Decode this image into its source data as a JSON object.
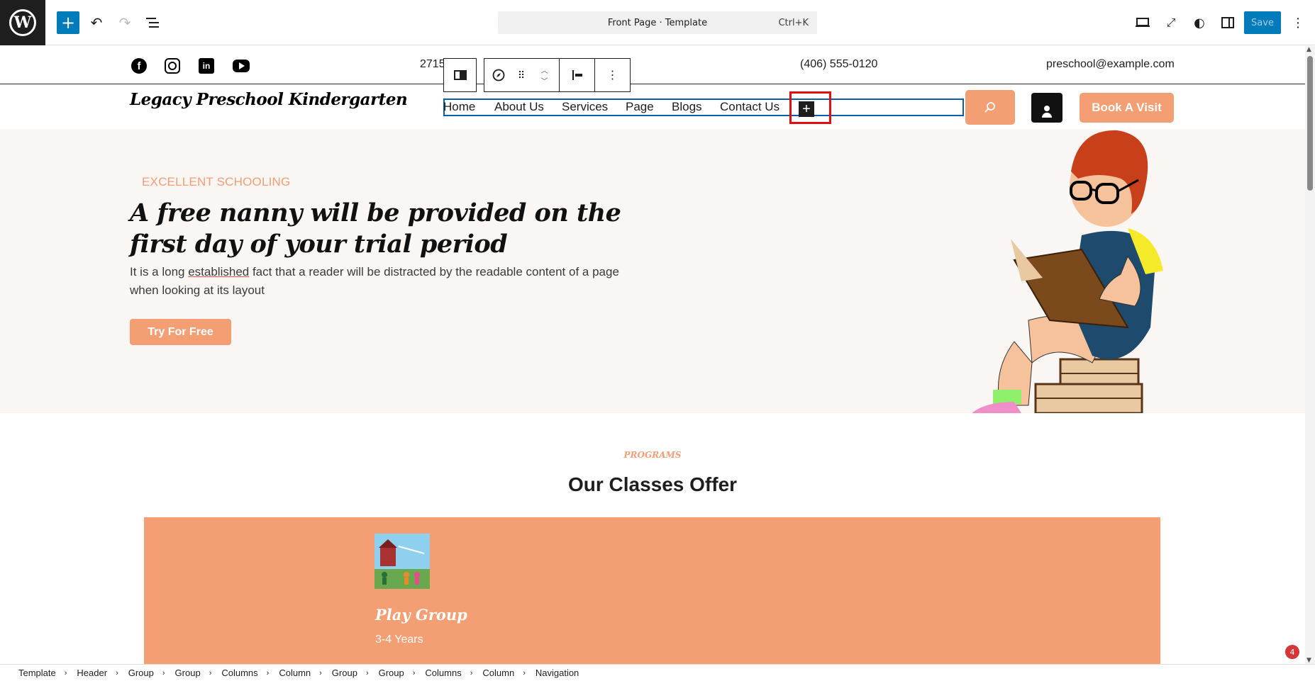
{
  "editor": {
    "command_label": "Front Page · Template",
    "command_shortcut": "Ctrl+K",
    "save_label": "Save",
    "notice_count": "4"
  },
  "site": {
    "address": "2715",
    "phone": "(406) 555-0120",
    "email": "preschool@example.com",
    "title": "Legacy Preschool Kindergarten",
    "nav": [
      "Home",
      "About Us",
      "Services",
      "Page",
      "Blogs",
      "Contact Us"
    ],
    "book_label": "Book A Visit"
  },
  "hero": {
    "eyebrow": "EXCELLENT SCHOOLING",
    "title": "A free nanny will be provided on the first day of your trial period",
    "text_before": "It is a long ",
    "text_underlined": "established",
    "text_after": " fact that a reader will be distracted by the readable content of a page when looking at its layout",
    "cta": "Try For Free"
  },
  "programs": {
    "eyebrow": "PROGRAMS",
    "title": "Our Classes Offer",
    "card_title": "Play Group",
    "card_sub": "3-4 Years"
  },
  "breadcrumbs": [
    "Template",
    "Header",
    "Group",
    "Group",
    "Columns",
    "Column",
    "Group",
    "Group",
    "Columns",
    "Column",
    "Navigation"
  ],
  "colors": {
    "accent": "#f49e74",
    "wp_blue": "#007cba",
    "selection_red": "#e01010"
  }
}
